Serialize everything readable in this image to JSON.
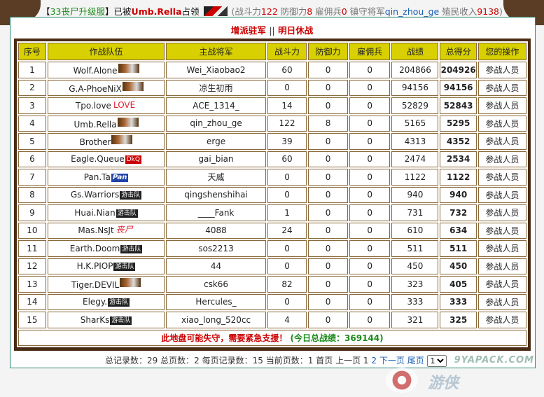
{
  "header": {
    "open_bracket": "【",
    "server": "33丧尸升级服",
    "close_bracket": "】",
    "occupied_by": "已被",
    "occupier": "Umb.Rella",
    "occupied": "占领",
    "stats_open": "(",
    "attack_label": "战斗力",
    "attack": "122",
    "defense_label": "防御力",
    "defense": "8",
    "mercenary_label": "雇佣兵",
    "mercenary": "0",
    "garrison_label": "镇守将军",
    "garrison_general": "qin_zhou_ge",
    "income_label": "殖民收入",
    "income": "9138",
    "stats_close": ")"
  },
  "actions": {
    "reinforce": "增派驻军",
    "separator": "||",
    "tomorrow_rest": "明日休战"
  },
  "table": {
    "columns": [
      "序号",
      "作战队伍",
      "主战将军",
      "战斗力",
      "防御力",
      "雇佣兵",
      "战绩",
      "总得分",
      "您的操作"
    ],
    "rows": [
      {
        "no": "1",
        "team": "Wolf.Alone",
        "badge": "pic",
        "badge_text": "",
        "commander": "Wei_Xiaobao2",
        "attack": "60",
        "defense": "0",
        "merc": "0",
        "record": "204866",
        "total": "204926",
        "op": "参战人员"
      },
      {
        "no": "2",
        "team": "G.A-PhoeNiX",
        "badge": "pic",
        "badge_text": "",
        "commander": "凉生初雨",
        "attack": "0",
        "defense": "0",
        "merc": "0",
        "record": "94156",
        "total": "94156",
        "op": "参战人员"
      },
      {
        "no": "3",
        "team": "Tpo.love",
        "badge": "love",
        "badge_text": "LOVE",
        "commander": "ACE_1314_",
        "attack": "14",
        "defense": "0",
        "merc": "0",
        "record": "52829",
        "total": "52843",
        "op": "参战人员"
      },
      {
        "no": "4",
        "team": "Umb.Rella",
        "badge": "pic",
        "badge_text": "",
        "commander": "qin_zhou_ge",
        "attack": "122",
        "defense": "8",
        "merc": "0",
        "record": "5165",
        "total": "5295",
        "op": "参战人员"
      },
      {
        "no": "5",
        "team": "Brother",
        "badge": "pic",
        "badge_text": "",
        "commander": "erge",
        "attack": "39",
        "defense": "0",
        "merc": "0",
        "record": "4313",
        "total": "4352",
        "op": "参战人员"
      },
      {
        "no": "6",
        "team": "Eagle.Queue",
        "badge": "red",
        "badge_text": "DkQ",
        "commander": "gai_bian",
        "attack": "60",
        "defense": "0",
        "merc": "0",
        "record": "2474",
        "total": "2534",
        "op": "参战人员"
      },
      {
        "no": "7",
        "team": "Pan.Ta",
        "badge": "blue",
        "badge_text": "Pan",
        "commander": "天威",
        "attack": "0",
        "defense": "0",
        "merc": "0",
        "record": "1122",
        "total": "1122",
        "op": "参战人员"
      },
      {
        "no": "8",
        "team": "Gs.Warriors",
        "badge": "text",
        "badge_text": "游击队",
        "commander": "qingshenshihai",
        "attack": "0",
        "defense": "0",
        "merc": "0",
        "record": "940",
        "total": "940",
        "op": "参战人员"
      },
      {
        "no": "9",
        "team": "Huai.Nian",
        "badge": "text",
        "badge_text": "游击队",
        "commander": "____Fank",
        "attack": "1",
        "defense": "0",
        "merc": "0",
        "record": "731",
        "total": "732",
        "op": "参战人员"
      },
      {
        "no": "10",
        "team": "Mas.NsJt",
        "badge": "zombie",
        "badge_text": "丧尸",
        "commander": "4088",
        "attack": "24",
        "defense": "0",
        "merc": "0",
        "record": "610",
        "total": "634",
        "op": "参战人员"
      },
      {
        "no": "11",
        "team": "Earth.Doom",
        "badge": "text",
        "badge_text": "游击队",
        "commander": "sos2213",
        "attack": "0",
        "defense": "0",
        "merc": "0",
        "record": "511",
        "total": "511",
        "op": "参战人员"
      },
      {
        "no": "12",
        "team": "H.K.PIOP",
        "badge": "text",
        "badge_text": "游击队",
        "commander": "44",
        "attack": "0",
        "defense": "0",
        "merc": "0",
        "record": "450",
        "total": "450",
        "op": "参战人员"
      },
      {
        "no": "13",
        "team": "Tiger.DEVIL",
        "badge": "pic",
        "badge_text": "",
        "commander": "csk66",
        "attack": "82",
        "defense": "0",
        "merc": "0",
        "record": "323",
        "total": "405",
        "op": "参战人员"
      },
      {
        "no": "14",
        "team": "Elegy.",
        "badge": "text",
        "badge_text": "游击队",
        "commander": "Hercules_",
        "attack": "0",
        "defense": "0",
        "merc": "0",
        "record": "333",
        "total": "333",
        "op": "参战人员"
      },
      {
        "no": "15",
        "team": "SharKs",
        "badge": "text",
        "badge_text": "游击队",
        "commander": "xiao_long_520cc",
        "attack": "4",
        "defense": "0",
        "merc": "0",
        "record": "321",
        "total": "325",
        "op": "参战人员"
      }
    ],
    "footer_warning": "此地盘可能失守，需要紧急支援！",
    "footer_total_label": "(今日总战绩：",
    "footer_total": "369144",
    "footer_total_close": ")"
  },
  "pager": {
    "total_records_label": "总记录数：",
    "total_records": "29",
    "total_pages_label": "总页数：",
    "total_pages": "2",
    "per_page_label": "每页记录数：",
    "per_page": "15",
    "current_page_label": "当前页数：",
    "current_page": "1",
    "first": "首页",
    "prev": "上一页",
    "page1": "1",
    "page2": "2",
    "next": "下一页",
    "last": "尾页",
    "select_value": "1"
  },
  "watermark": {
    "site": "9YAPACK.COM",
    "cn": "游侠"
  },
  "colors": {
    "header_yellow": "#d8d000",
    "border_brown": "#4a2c14",
    "score_red": "#e00000",
    "link_blue": "#1a5fb4"
  }
}
